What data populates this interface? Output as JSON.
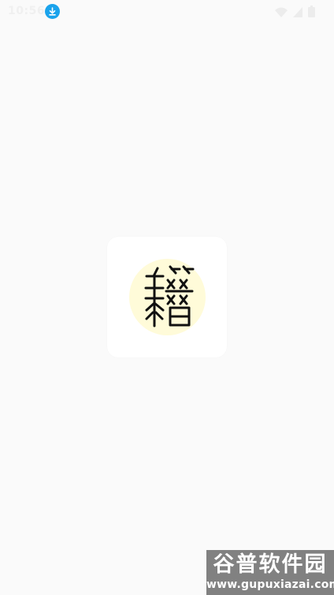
{
  "status_bar": {
    "time": "10:56",
    "download_icon": "download-icon",
    "wifi_icon": "wifi-icon",
    "signal_icon": "signal-icon",
    "battery_icon": "battery-icon"
  },
  "splash": {
    "logo_glyph": "籍",
    "logo_bg_color": "#fffbd9",
    "card_color": "#ffffff"
  },
  "watermark": {
    "title": "谷普软件园",
    "url": "www.gupuxiazai.com"
  }
}
